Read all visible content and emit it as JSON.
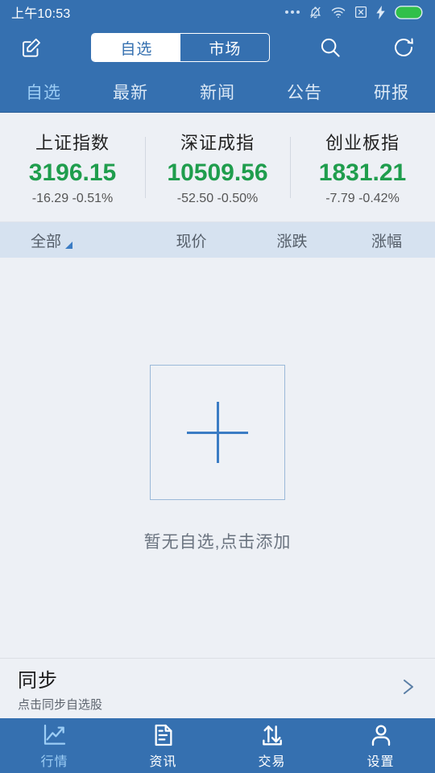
{
  "status_bar": {
    "time": "上午10:53",
    "icons": [
      "more-dots-icon",
      "bell-muted-icon",
      "wifi-icon",
      "no-sim-icon",
      "charging-bolt-icon",
      "battery-icon"
    ]
  },
  "header": {
    "edit_icon": "edit-pencil-icon",
    "segments": [
      {
        "label": "自选",
        "active": true
      },
      {
        "label": "市场",
        "active": false
      }
    ],
    "search_icon": "search-icon",
    "refresh_icon": "refresh-icon"
  },
  "tabs": [
    {
      "label": "自选",
      "active": true
    },
    {
      "label": "最新",
      "active": false
    },
    {
      "label": "新闻",
      "active": false
    },
    {
      "label": "公告",
      "active": false
    },
    {
      "label": "研报",
      "active": false
    }
  ],
  "indices": [
    {
      "name": "上证指数",
      "value": "3196.15",
      "change": "-16.29 -0.51%"
    },
    {
      "name": "深证成指",
      "value": "10509.56",
      "change": "-52.50 -0.50%"
    },
    {
      "name": "创业板指",
      "value": "1831.21",
      "change": "-7.79 -0.42%"
    }
  ],
  "column_header": {
    "all": "全部",
    "price": "现价",
    "change": "涨跌",
    "percent": "涨幅"
  },
  "empty_state": {
    "add_icon": "plus-icon",
    "text": "暂无自选,点击添加"
  },
  "sync_row": {
    "title": "同步",
    "subtitle": "点击同步自选股",
    "chevron": "chevron-right-icon"
  },
  "bottom_nav": [
    {
      "label": "行情",
      "icon": "chart-trend-icon",
      "active": true
    },
    {
      "label": "资讯",
      "icon": "document-icon",
      "active": false
    },
    {
      "label": "交易",
      "icon": "transfer-arrows-icon",
      "active": false
    },
    {
      "label": "设置",
      "icon": "person-icon",
      "active": false
    }
  ],
  "colors": {
    "brand_blue": "#3570b0",
    "down_green": "#1f9d4d",
    "bg_grey": "#edf0f5",
    "column_header_bg": "#d6e2f0",
    "accent_light_blue": "#9ccdf5"
  }
}
